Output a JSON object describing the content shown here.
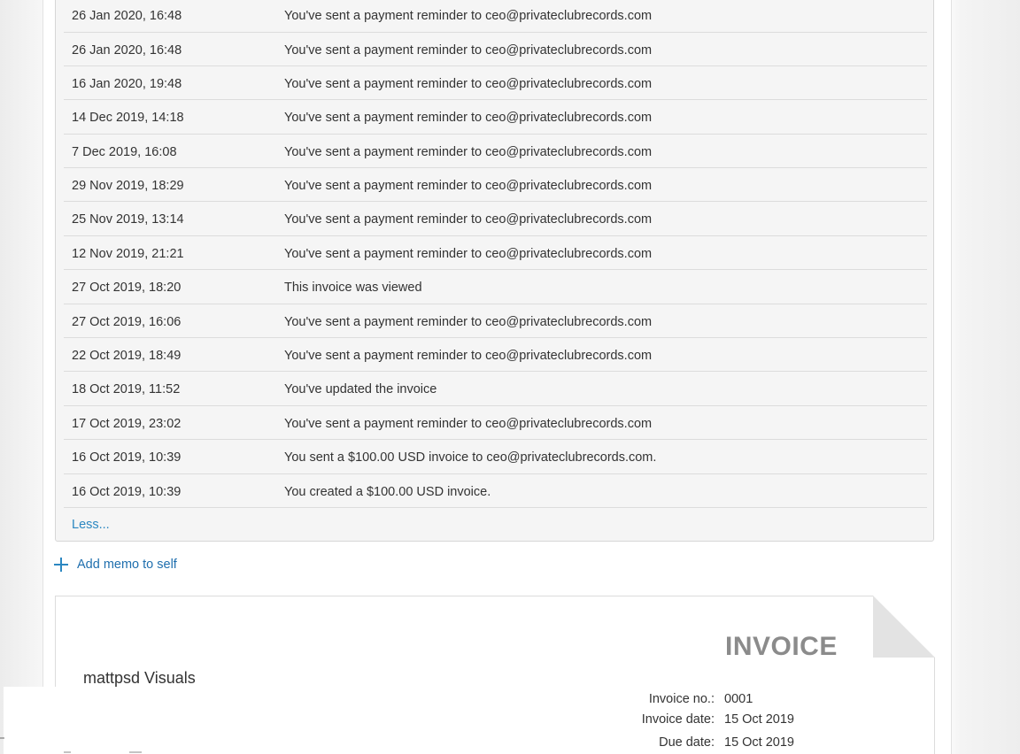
{
  "activity": [
    {
      "date": "26 Jan 2020, 16:48",
      "text": "You've sent a payment reminder to ceo@privateclubrecords.com"
    },
    {
      "date": "26 Jan 2020, 16:48",
      "text": "You've sent a payment reminder to ceo@privateclubrecords.com"
    },
    {
      "date": "16 Jan 2020, 19:48",
      "text": "You've sent a payment reminder to ceo@privateclubrecords.com"
    },
    {
      "date": "14 Dec 2019, 14:18",
      "text": "You've sent a payment reminder to ceo@privateclubrecords.com"
    },
    {
      "date": "7 Dec 2019, 16:08",
      "text": "You've sent a payment reminder to ceo@privateclubrecords.com"
    },
    {
      "date": "29 Nov 2019, 18:29",
      "text": "You've sent a payment reminder to ceo@privateclubrecords.com"
    },
    {
      "date": "25 Nov 2019, 13:14",
      "text": "You've sent a payment reminder to ceo@privateclubrecords.com"
    },
    {
      "date": "12 Nov 2019, 21:21",
      "text": "You've sent a payment reminder to ceo@privateclubrecords.com"
    },
    {
      "date": "27 Oct 2019, 18:20",
      "text": "This invoice was viewed"
    },
    {
      "date": "27 Oct 2019, 16:06",
      "text": "You've sent a payment reminder to ceo@privateclubrecords.com"
    },
    {
      "date": "22 Oct 2019, 18:49",
      "text": "You've sent a payment reminder to ceo@privateclubrecords.com"
    },
    {
      "date": "18 Oct 2019, 11:52",
      "text": "You've updated the invoice"
    },
    {
      "date": "17 Oct 2019, 23:02",
      "text": "You've sent a payment reminder to ceo@privateclubrecords.com"
    },
    {
      "date": "16 Oct 2019, 10:39",
      "text": "You sent a $100.00 USD invoice to ceo@privateclubrecords.com."
    },
    {
      "date": "16 Oct 2019, 10:39",
      "text": "You created a $100.00 USD invoice."
    }
  ],
  "less_link": "Less...",
  "memo_link": {
    "label": "Add memo to self",
    "icon": "plus-icon"
  },
  "invoice": {
    "title": "INVOICE",
    "company": "mattpsd Visuals",
    "number_label": "Invoice no.:",
    "number": "0001",
    "date_label": "Invoice date:",
    "date": "15 Oct 2019",
    "due_label": "Due date:",
    "due": "15 Oct 2019"
  },
  "colors": {
    "link": "#2b87c1",
    "panel_bg": "#f5f5f5",
    "invoice_title": "#8b8b8b"
  }
}
